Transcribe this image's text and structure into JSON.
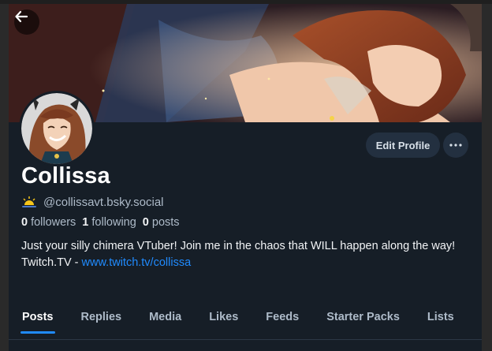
{
  "profile": {
    "display_name": "Collissa",
    "handle": "@collissavt.bsky.social",
    "stats": {
      "followers_count": "0",
      "followers_label": "followers",
      "following_count": "1",
      "following_label": "following",
      "posts_count": "0",
      "posts_label": "posts"
    },
    "bio_line1": "Just your silly chimera VTuber! Join me in the chaos that WILL happen along the way!",
    "bio_link_prefix": "Twitch.TV - ",
    "bio_link": "www.twitch.tv/collissa"
  },
  "actions": {
    "edit_profile_label": "Edit Profile"
  },
  "tabs": [
    {
      "label": "Posts",
      "active": true
    },
    {
      "label": "Replies",
      "active": false
    },
    {
      "label": "Media",
      "active": false
    },
    {
      "label": "Likes",
      "active": false
    },
    {
      "label": "Feeds",
      "active": false
    },
    {
      "label": "Starter Packs",
      "active": false
    },
    {
      "label": "Lists",
      "active": false
    }
  ],
  "icons": {
    "back": "arrow-left-icon",
    "more": "ellipsis-icon",
    "handle_badge": "sunrise-icon"
  },
  "colors": {
    "background": "#161e27",
    "accent": "#208bfe",
    "button_bg": "#233040",
    "muted_text": "#aebbc9"
  }
}
